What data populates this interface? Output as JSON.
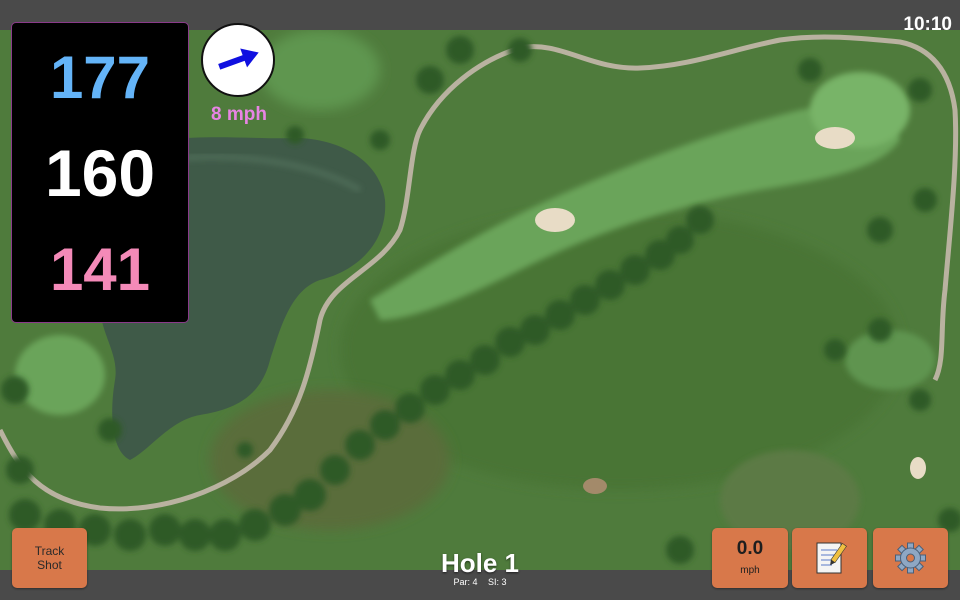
{
  "status_bar": {
    "time": "10:10"
  },
  "yardages": {
    "back": "177",
    "middle": "160",
    "front": "141",
    "back_color": "#64b4f8",
    "middle_color": "#ffffff",
    "front_color": "#f48ab8"
  },
  "wind": {
    "speed": "8 mph",
    "speed_color": "#e884e4",
    "arrow_color": "#1010e0",
    "direction_icon": "arrow-up-right"
  },
  "buttons": {
    "track_shot_line1": "Track",
    "track_shot_line2": "Shot",
    "speed_value": "0.0",
    "speed_unit": "mph",
    "notes_icon": "notepad-icon",
    "settings_icon": "gear-icon"
  },
  "hole": {
    "title": "Hole 1",
    "par": "Par: 4",
    "si": "SI: 3"
  },
  "colors": {
    "button_bg": "#d8784a",
    "bar_bg": "#4a4a4a",
    "rough": "#4d7a3a",
    "fairway": "#6aa45a",
    "water": "#3f5a48",
    "path": "#b9b2a0"
  }
}
